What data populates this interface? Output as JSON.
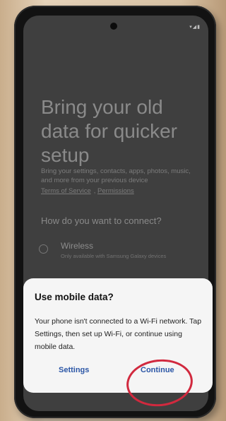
{
  "status_bar": {
    "icons_text": "▾◢▮"
  },
  "setup": {
    "title": "Bring your old data for quicker setup",
    "description": "Bring your settings, contacts, apps, photos, music, and more from your previous device",
    "links": [
      "Terms of Service",
      "Permissions"
    ],
    "question": "How do you want to connect?",
    "option": {
      "title": "Wireless",
      "subtitle": "Only available with Samsung Galaxy devices"
    }
  },
  "dialog": {
    "title": "Use mobile data?",
    "body": "Your phone isn't connected to a Wi-Fi network. Tap Settings, then set up Wi-Fi, or continue using mobile data.",
    "settings_label": "Settings",
    "continue_label": "Continue"
  },
  "colors": {
    "accent": "#2b56a6",
    "annotation": "#d1293e"
  }
}
